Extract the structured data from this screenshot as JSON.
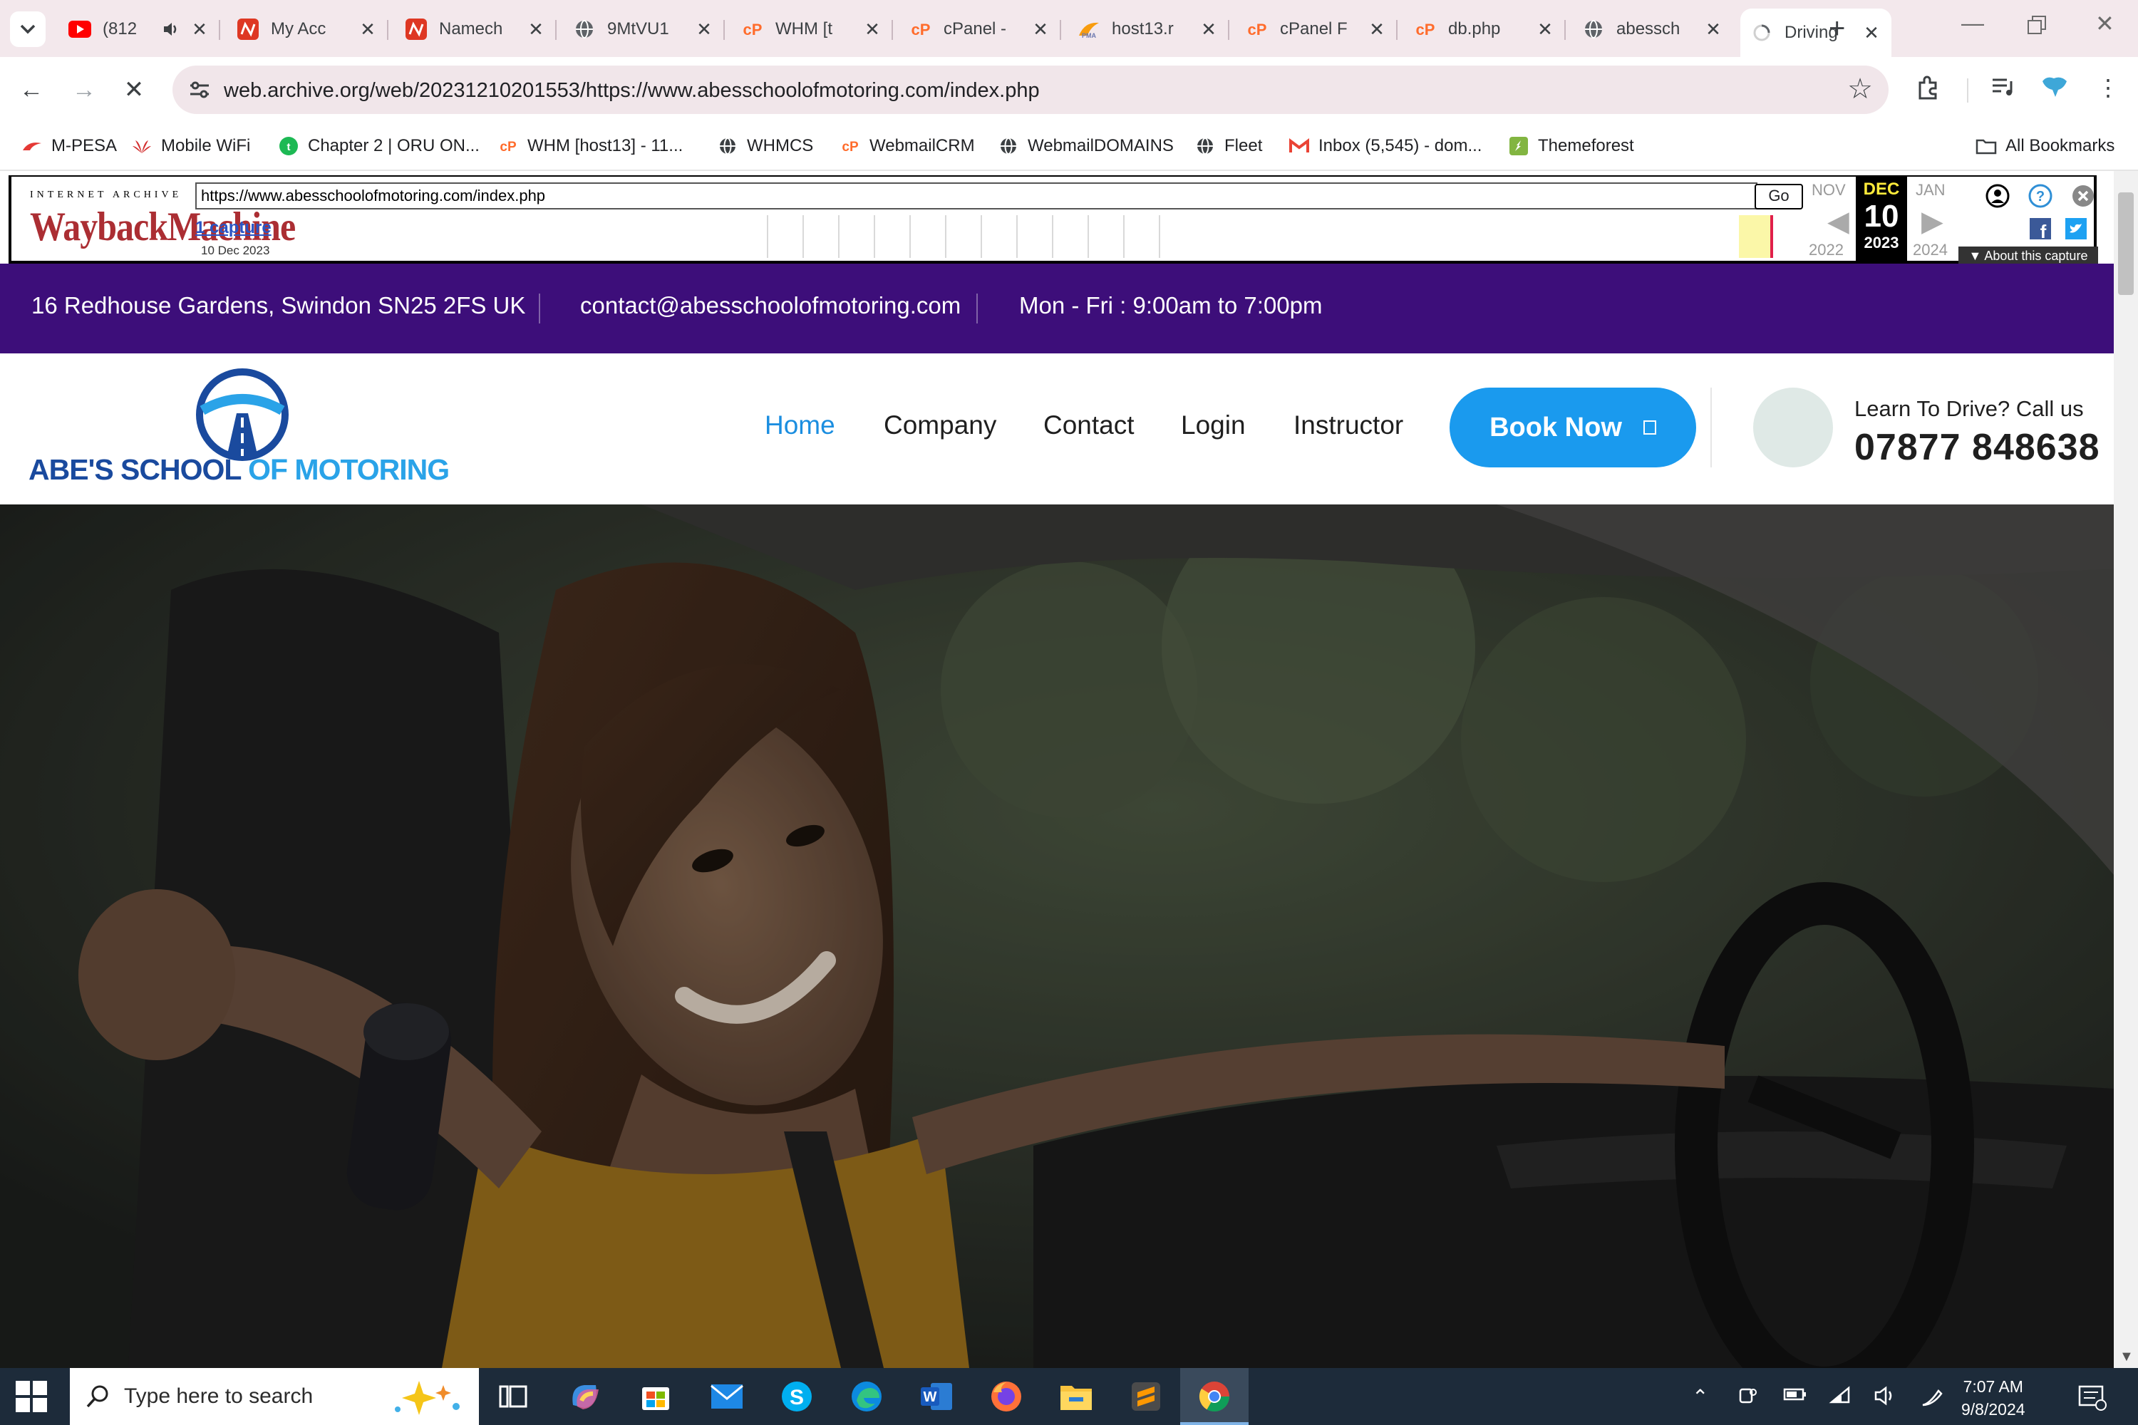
{
  "browser": {
    "tabs": [
      {
        "title": "(812",
        "icon": "youtube-icon",
        "color": "#ff0000",
        "audio": true
      },
      {
        "title": "My Acc",
        "icon": "namecheap-icon",
        "color": "#de3723"
      },
      {
        "title": "Namech",
        "icon": "namecheap-icon",
        "color": "#de3723"
      },
      {
        "title": "9MtVU1",
        "icon": "globe-icon",
        "color": "#5f6368"
      },
      {
        "title": "WHM [t",
        "icon": "cpanel-icon",
        "color": "#ff6c2c"
      },
      {
        "title": "cPanel -",
        "icon": "cpanel-icon",
        "color": "#ff6c2c"
      },
      {
        "title": "host13.r",
        "icon": "phpmyadmin-icon",
        "color": "#f89c0e"
      },
      {
        "title": "cPanel F",
        "icon": "cpanel-icon",
        "color": "#ff6c2c"
      },
      {
        "title": "db.php",
        "icon": "cpanel-icon",
        "color": "#ff6c2c"
      },
      {
        "title": "abessch",
        "icon": "globe-icon",
        "color": "#5f6368"
      },
      {
        "title": "Driving",
        "icon": "loading-icon",
        "color": "#5f6368",
        "active": true
      }
    ],
    "url": "web.archive.org/web/20231210201553/https://www.abesschoolofmotoring.com/index.php",
    "bookmarks": [
      {
        "label": "M-PESA",
        "icon": "mpesa-icon",
        "color": "#e53935"
      },
      {
        "label": "Mobile WiFi",
        "icon": "huawei-icon",
        "color": "#d32f2f"
      },
      {
        "label": "Chapter 2 | ORU ON...",
        "icon": "chapter-icon",
        "color": "#1db954"
      },
      {
        "label": "WHM [host13] - 11...",
        "icon": "cpanel-icon",
        "color": "#ff6c2c"
      },
      {
        "label": "WHMCS",
        "icon": "globe-icon",
        "color": "#3c4043"
      },
      {
        "label": "WebmailCRM",
        "icon": "cpanel-icon",
        "color": "#ff6c2c"
      },
      {
        "label": "WebmailDOMAINS",
        "icon": "globe-icon",
        "color": "#3c4043"
      },
      {
        "label": "Fleet",
        "icon": "globe-icon",
        "color": "#3c4043"
      },
      {
        "label": "Inbox (5,545) - dom...",
        "icon": "gmail-icon",
        "color": "#ea4335"
      },
      {
        "label": "Themeforest",
        "icon": "themeforest-icon",
        "color": "#82b541"
      }
    ],
    "all_bookmarks": "All Bookmarks"
  },
  "wayback": {
    "logo_top": "INTERNET ARCHIVE",
    "logo": "WaybackMachine",
    "url_value": "https://www.abesschoolofmotoring.com/index.php",
    "go": "Go",
    "captures": "1 capture",
    "capture_date": "10 Dec 2023",
    "prev_month": "NOV",
    "cur_month": "DEC",
    "next_month": "JAN",
    "day": "10",
    "prev_year": "2022",
    "cur_year": "2023",
    "next_year": "2024",
    "about": "About this capture"
  },
  "site": {
    "address": "16 Redhouse Gardens, Swindon SN25 2FS UK",
    "email": "contact@abesschoolofmotoring.com",
    "hours": "Mon - Fri : 9:00am to 7:00pm",
    "logo_main": "ABE'S SCHOOL ",
    "logo_accent": "OF MOTORING",
    "nav": [
      {
        "label": "Home",
        "active": true
      },
      {
        "label": "Company"
      },
      {
        "label": "Contact"
      },
      {
        "label": "Login"
      },
      {
        "label": "Instructor"
      }
    ],
    "book_now": "Book Now",
    "call_label": "Learn To Drive? Call us",
    "call_number": "07877 848638",
    "colors": {
      "infobar": "#3d0e7a",
      "accent": "#1a9aee",
      "logo": "#1a4a9e"
    }
  },
  "taskbar": {
    "search_placeholder": "Type here to search",
    "time": "7:07 AM",
    "date": "9/8/2024",
    "apps": [
      "task-view-icon",
      "copilot-icon",
      "store-icon",
      "mail-icon",
      "skype-icon",
      "edge-icon",
      "word-icon",
      "firefox-icon",
      "file-explorer-icon",
      "sublime-icon",
      "chrome-icon"
    ]
  }
}
